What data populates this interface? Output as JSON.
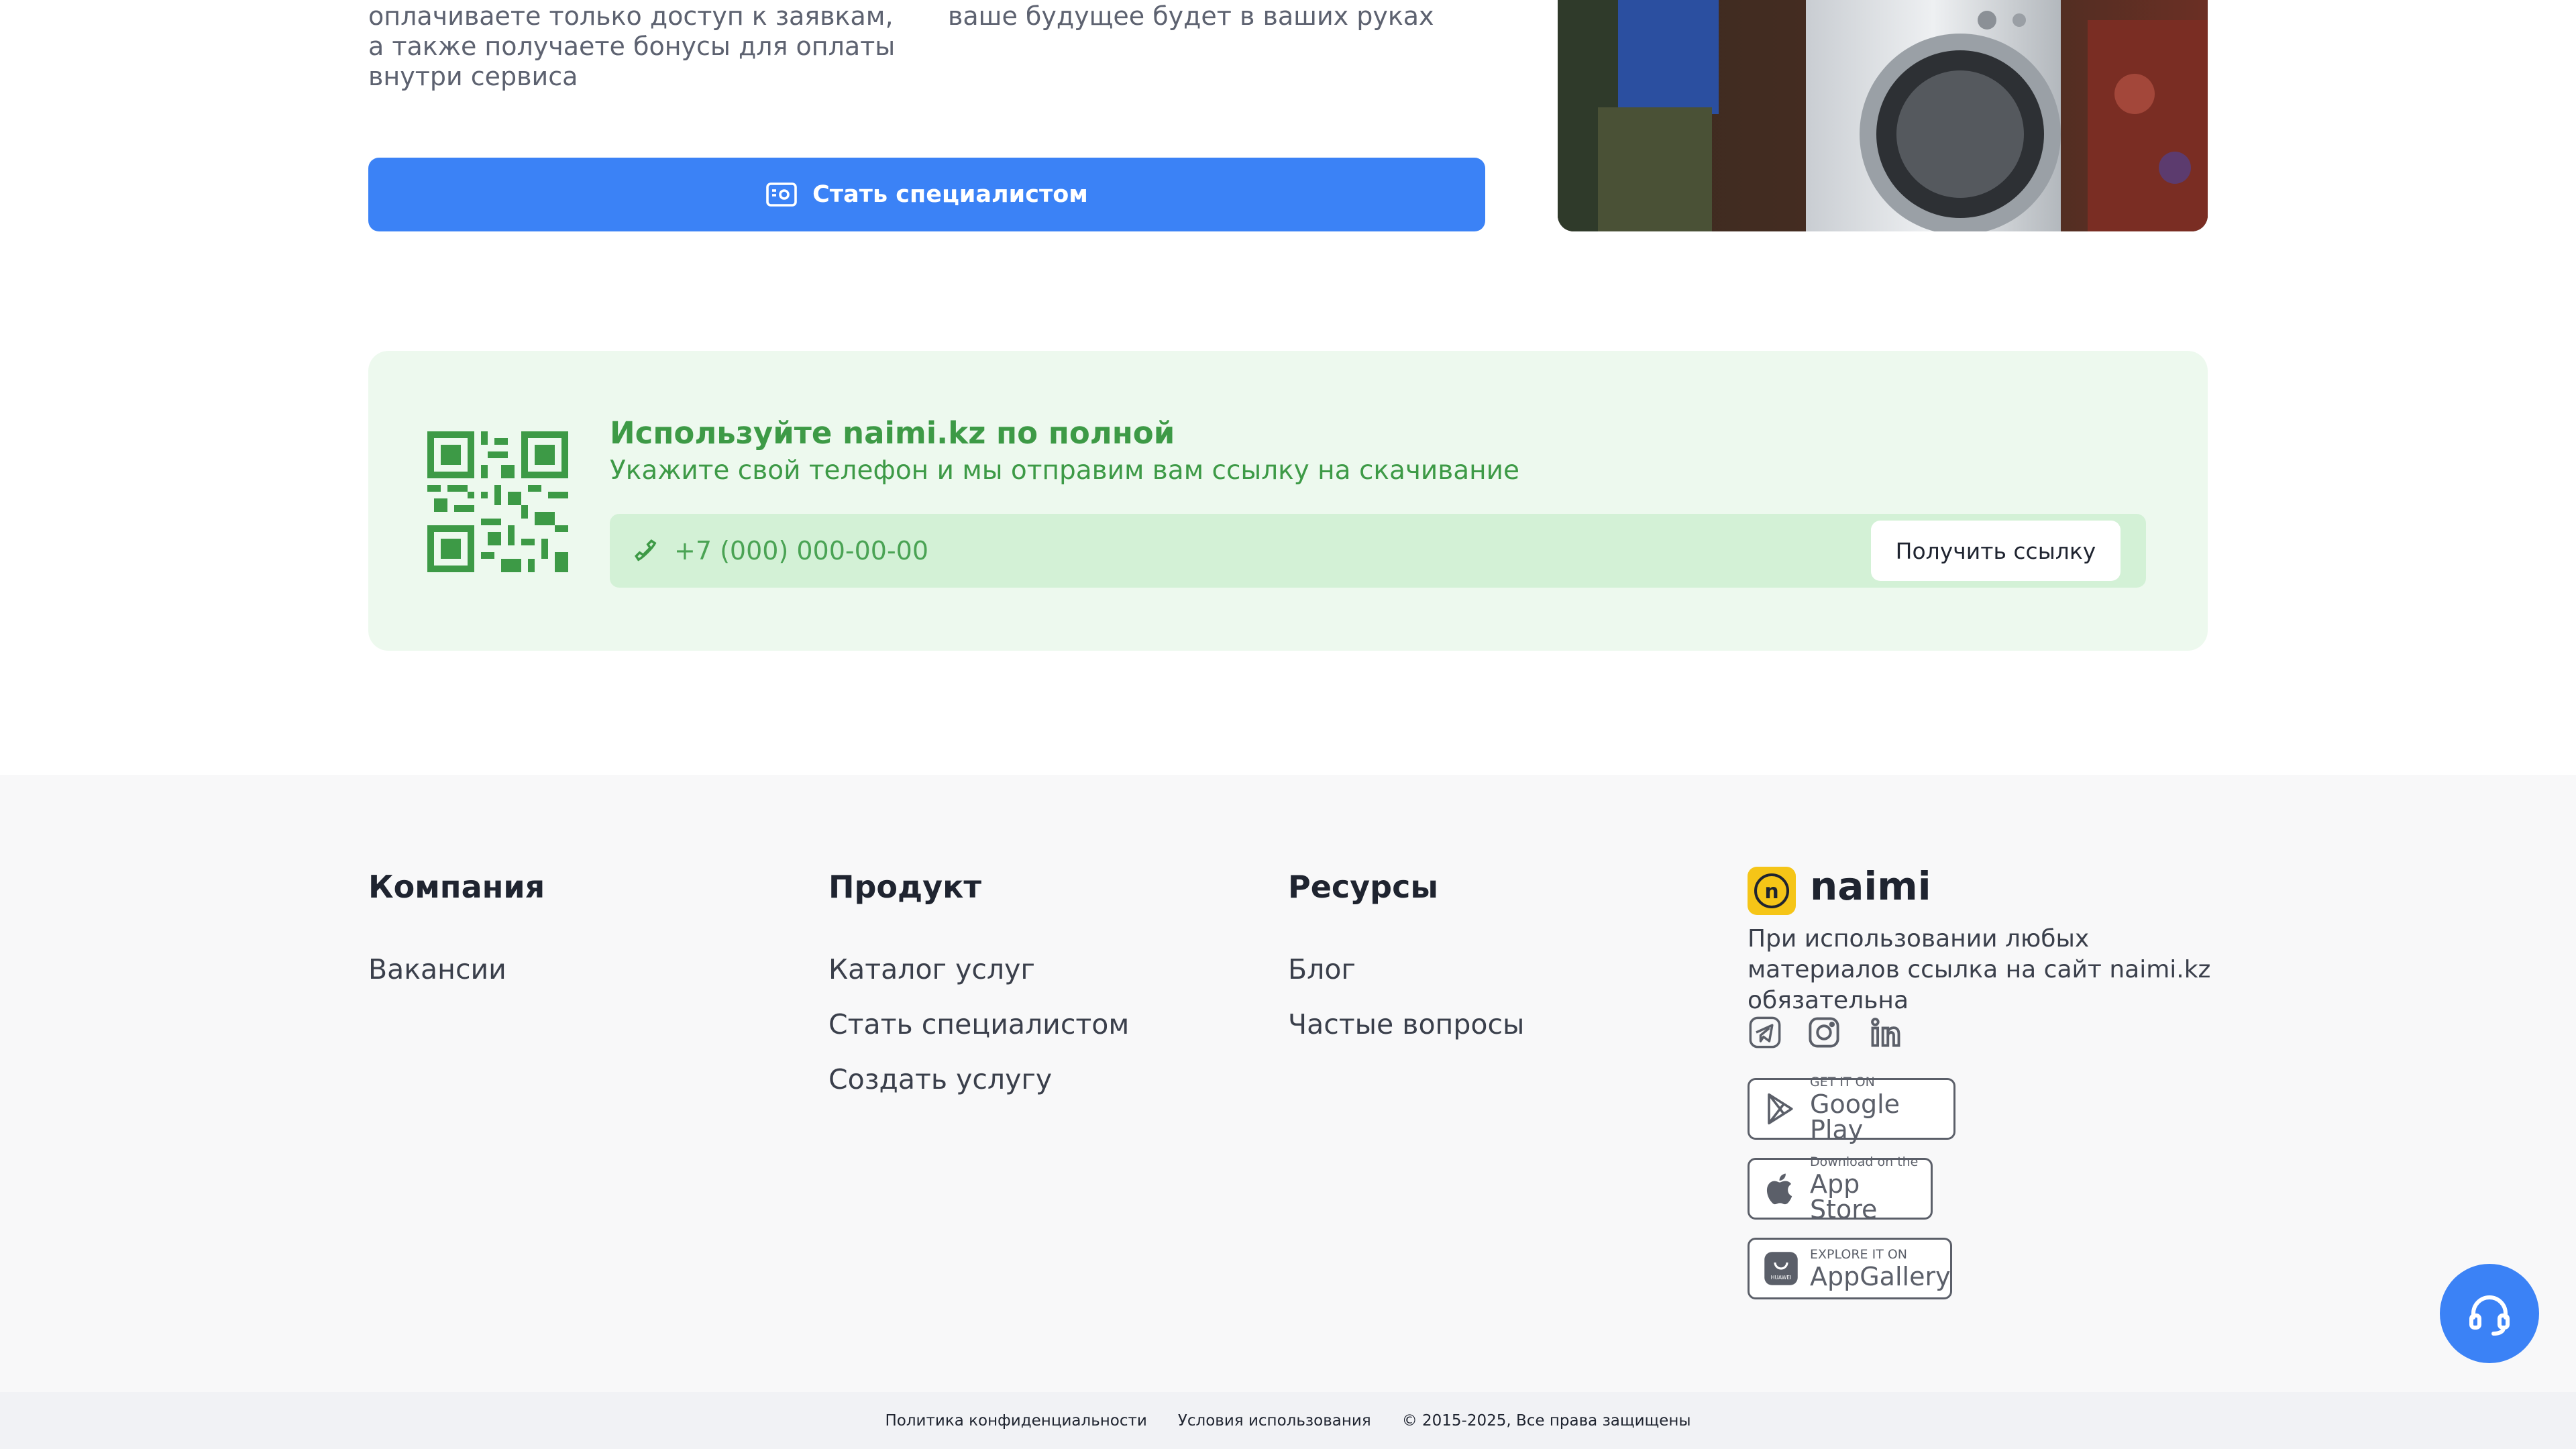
{
  "specialist": {
    "text_left": "оплачиваете только доступ к заявкам, а также получаете бонусы для оплаты внутри сервиса",
    "text_right": "ваше будущее будет в ваших руках",
    "button_label": "Стать специалистом"
  },
  "app_promo": {
    "title": "Используйте naimi.kz по полной",
    "subtitle": "Укажите свой телефон и мы отправим вам ссылку на скачивание",
    "phone_placeholder": "+7 (000) 000-00-00",
    "button_label": "Получить ссылку"
  },
  "footer": {
    "company": {
      "title": "Компания",
      "links": [
        "Вакансии"
      ]
    },
    "product": {
      "title": "Продукт",
      "links": [
        "Каталог услуг",
        "Стать специалистом",
        "Создать услугу"
      ]
    },
    "resources": {
      "title": "Ресурсы",
      "links": [
        "Блог",
        "Частые вопросы"
      ]
    },
    "brand": {
      "logo_letter": "n",
      "name": "naimi",
      "note": "При использовании любых материалов ссылка на сайт naimi.kz обязательна"
    },
    "social_icons": [
      "telegram-icon",
      "instagram-icon",
      "linkedin-icon"
    ],
    "stores": {
      "google": {
        "small": "GET IT ON",
        "big": "Google Play"
      },
      "apple": {
        "small": "Download on the",
        "big": "App Store"
      },
      "huawei": {
        "small": "EXPLORE IT ON",
        "big": "AppGallery",
        "logo_text": "HUAWEI"
      }
    }
  },
  "bottom_bar": {
    "privacy": "Политика конфиденциальности",
    "terms": "Условия использования",
    "copyright": "© 2015-2025, Все права защищены"
  },
  "colors": {
    "primary": "#3b82f6",
    "promo_bg": "#edf9ee",
    "promo_text": "#3d9a46",
    "brand_yellow": "#f5c517"
  }
}
